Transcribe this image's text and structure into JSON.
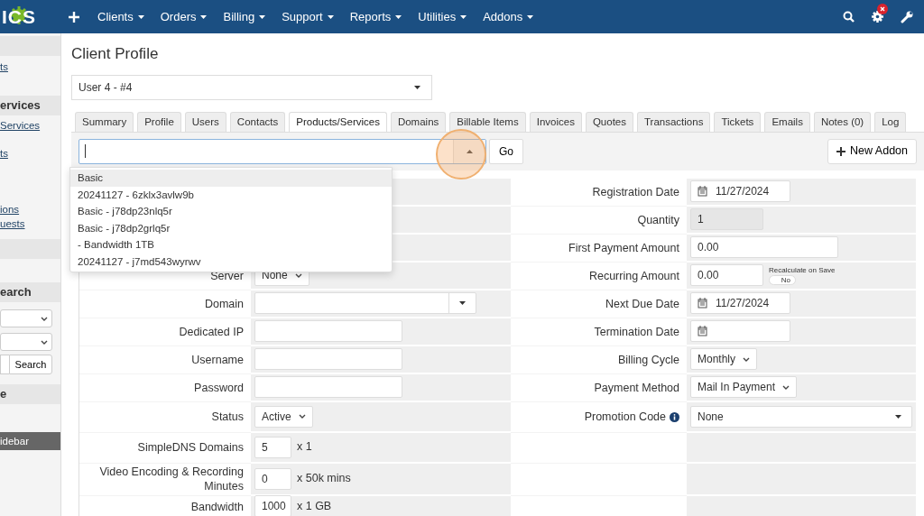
{
  "navbar": {
    "logo": "ICS",
    "items": [
      "Clients",
      "Orders",
      "Billing",
      "Support",
      "Reports",
      "Utilities",
      "Addons"
    ],
    "notification_count_badge": true
  },
  "sidebar": [
    {
      "kind": "header"
    },
    {
      "kind": "link",
      "text": "ts"
    },
    {
      "kind": "header",
      "text": "ervices"
    },
    {
      "kind": "link",
      "text": "Services"
    },
    {
      "kind": "link",
      "text": "ts"
    },
    {
      "kind": "link",
      "text": "ions"
    },
    {
      "kind": "link",
      "text": "uests"
    },
    {
      "kind": "header"
    },
    {
      "kind": "header",
      "text": "earch"
    },
    {
      "kind": "select"
    },
    {
      "kind": "select"
    },
    {
      "kind": "search",
      "button": "Search"
    },
    {
      "kind": "header",
      "text": "e"
    },
    {
      "kind": "bar",
      "text": "idebar"
    }
  ],
  "page_title": "Client Profile",
  "client_select": {
    "value": "User 4 - #4"
  },
  "tabs": [
    {
      "label": "Summary",
      "selected": false
    },
    {
      "label": "Profile",
      "selected": false
    },
    {
      "label": "Users",
      "selected": false
    },
    {
      "label": "Contacts",
      "selected": false
    },
    {
      "label": "Products/Services",
      "selected": true
    },
    {
      "label": "Domains",
      "selected": false
    },
    {
      "label": "Billable Items",
      "selected": false
    },
    {
      "label": "Invoices",
      "selected": false
    },
    {
      "label": "Quotes",
      "selected": false
    },
    {
      "label": "Transactions",
      "selected": false
    },
    {
      "label": "Tickets",
      "selected": false
    },
    {
      "label": "Emails",
      "selected": false
    },
    {
      "label": "Notes (0)",
      "selected": false
    },
    {
      "label": "Log",
      "selected": false
    }
  ],
  "product_picker": {
    "expanded": true,
    "click_highlight": true,
    "go_button": "Go",
    "options": [
      {
        "label": "Basic",
        "selected": true
      },
      {
        "label": "20241127 - 6zklx3avlw9b",
        "selected": false
      },
      {
        "label": "Basic - j78dp23nlq5r",
        "selected": false
      },
      {
        "label": "Basic - j78dp2grlq5r",
        "selected": false
      },
      {
        "label": "- Bandwidth 1TB",
        "selected": false
      },
      {
        "label": "20241127 - j7md543wyrwv",
        "selected": false
      }
    ]
  },
  "new_addon_button": "New Addon",
  "form_rows": [
    {
      "right": {
        "label": "Registration Date",
        "kind": "date",
        "value": "11/27/2024"
      }
    },
    {
      "right": {
        "label": "Quantity",
        "kind": "readonly",
        "value": "1"
      }
    },
    {
      "right": {
        "label": "First Payment Amount",
        "kind": "text",
        "value": "0.00"
      }
    },
    {
      "left": {
        "label": "Server",
        "kind": "select",
        "value": "None"
      },
      "right": {
        "label": "Recurring Amount",
        "kind": "money",
        "value": "0.00",
        "toggle_label": "Recalculate on Save",
        "toggle_text": "No",
        "on": false
      }
    },
    {
      "left": {
        "label": "Domain",
        "kind": "combo"
      },
      "right": {
        "label": "Next Due Date",
        "kind": "date",
        "value": "11/27/2024"
      }
    },
    {
      "left": {
        "label": "Dedicated IP",
        "kind": "text"
      },
      "right": {
        "label": "Termination Date",
        "kind": "date"
      }
    },
    {
      "left": {
        "label": "Username",
        "kind": "text"
      },
      "right": {
        "label": "Billing Cycle",
        "kind": "select",
        "value": "Monthly"
      }
    },
    {
      "left": {
        "label": "Password",
        "kind": "text"
      },
      "right": {
        "label": "Payment Method",
        "kind": "select",
        "value": "Mail In Payment"
      }
    },
    {
      "left": {
        "label": "Status",
        "kind": "select",
        "value": "Active"
      },
      "right": {
        "label": "Promotion Code",
        "kind": "combo",
        "value": "None",
        "info": true
      }
    },
    {
      "left": {
        "label": "SimpleDNS Domains",
        "kind": "number",
        "value": "5",
        "suffix": "x 1"
      }
    },
    {
      "left": {
        "label": "Video Encoding & Recording Minutes",
        "kind": "number",
        "value": "0",
        "suffix": "x 50k mins"
      }
    },
    {
      "left": {
        "label": "Bandwidth",
        "kind": "number",
        "value": "1000",
        "suffix": "x 1 GB"
      }
    }
  ]
}
